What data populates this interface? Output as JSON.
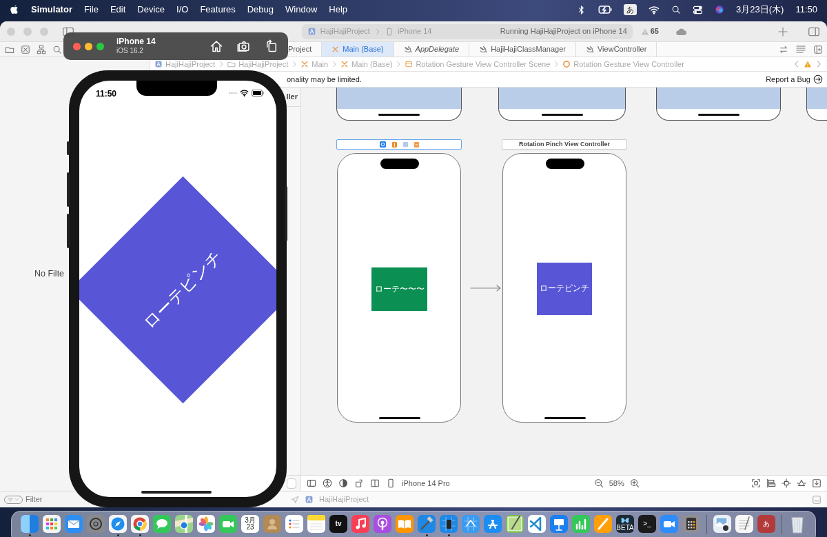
{
  "menu_bar": {
    "app_name": "Simulator",
    "menus": [
      "File",
      "Edit",
      "Device",
      "I/O",
      "Features",
      "Debug",
      "Window",
      "Help"
    ],
    "input_source": "あ",
    "date": "3月23日(木)",
    "time": "11:50"
  },
  "xcode": {
    "toolbar": {
      "scheme": "HajiHajiProject",
      "destination": "iPhone 14",
      "activity": "Running HajiHajiProject on iPhone 14",
      "warning_count": "65"
    },
    "tabs": [
      {
        "label": "Project",
        "selected": false,
        "preview": false
      },
      {
        "label": "Main (Base)",
        "selected": true,
        "preview": false
      },
      {
        "label": "AppDelegate",
        "selected": false,
        "preview": true
      },
      {
        "label": "HajiHajiClassManager",
        "selected": false,
        "preview": false
      },
      {
        "label": "ViewController",
        "selected": false,
        "preview": false
      }
    ],
    "breadcrumb": [
      {
        "label": "HajiHajiProject",
        "kind": "project"
      },
      {
        "label": "HajiHajiProject",
        "kind": "folder"
      },
      {
        "label": "Main",
        "kind": "storyboard"
      },
      {
        "label": "Main (Base)",
        "kind": "storyboard"
      },
      {
        "label": "Rotation Gesture View Controller Scene",
        "kind": "scene"
      },
      {
        "label": "Rotation Gesture View Controller",
        "kind": "controller"
      }
    ],
    "notice": "onality may be limited.",
    "report_bug": "Report a Bug",
    "navigator": {
      "empty_text": "No Filte",
      "filter_placeholder": "Filter"
    },
    "outline": {
      "header": "ller"
    },
    "canvas": {
      "scenes": [
        {
          "kind": "icons",
          "selected": true,
          "view": {
            "label": "ローテ〜〜〜",
            "color": "#0b8f52"
          }
        },
        {
          "kind": "titled",
          "title": "Rotation Pinch View Controller",
          "selected": false,
          "view": {
            "label": "ローテピンチ",
            "color": "#5856d6"
          }
        }
      ]
    },
    "device": "iPhone 14 Pro",
    "zoom": "58%",
    "debug_target": "HajiHajiProject"
  },
  "simulator": {
    "device": "iPhone 14",
    "os": "iOS 16.2",
    "status_time": "11:50",
    "view": {
      "label": "ローテピンチ",
      "color": "#5856d6"
    }
  },
  "dock": [
    {
      "kind": "finder",
      "running": true
    },
    {
      "kind": "launchpad",
      "running": false
    },
    {
      "kind": "mail",
      "running": false
    },
    {
      "kind": "settings",
      "running": false
    },
    {
      "kind": "safari",
      "running": true
    },
    {
      "kind": "chrome",
      "running": true
    },
    {
      "kind": "messages",
      "running": false
    },
    {
      "kind": "maps",
      "running": false
    },
    {
      "kind": "photos",
      "running": false
    },
    {
      "kind": "facetime",
      "running": false
    },
    {
      "kind": "calendar",
      "running": false,
      "month": "3月",
      "day": "23"
    },
    {
      "kind": "contacts",
      "running": false
    },
    {
      "kind": "reminders",
      "running": false
    },
    {
      "kind": "notes",
      "running": false
    },
    {
      "kind": "tv",
      "running": false,
      "label": "tv"
    },
    {
      "kind": "music",
      "running": false
    },
    {
      "kind": "podcasts",
      "running": false
    },
    {
      "kind": "books",
      "running": false
    },
    {
      "kind": "xcode",
      "running": true
    },
    {
      "kind": "simulator",
      "running": true
    },
    {
      "kind": "blueprint",
      "running": false
    },
    {
      "kind": "appstore",
      "running": false
    },
    {
      "kind": "sketch",
      "running": false
    },
    {
      "kind": "editor",
      "running": false
    },
    {
      "kind": "keynote",
      "running": false
    },
    {
      "kind": "numbers",
      "running": false
    },
    {
      "kind": "pages",
      "running": false
    },
    {
      "kind": "beta",
      "running": false,
      "label": "BETA"
    },
    {
      "kind": "terminal",
      "running": false,
      "label": ">_"
    },
    {
      "kind": "zoom",
      "running": false
    },
    {
      "kind": "calculator",
      "running": false
    },
    {
      "kind": "separator"
    },
    {
      "kind": "preview",
      "running": false
    },
    {
      "kind": "textedit",
      "running": false
    },
    {
      "kind": "kana",
      "running": false,
      "label": "あ"
    },
    {
      "kind": "separator"
    },
    {
      "kind": "trash",
      "running": false
    }
  ]
}
